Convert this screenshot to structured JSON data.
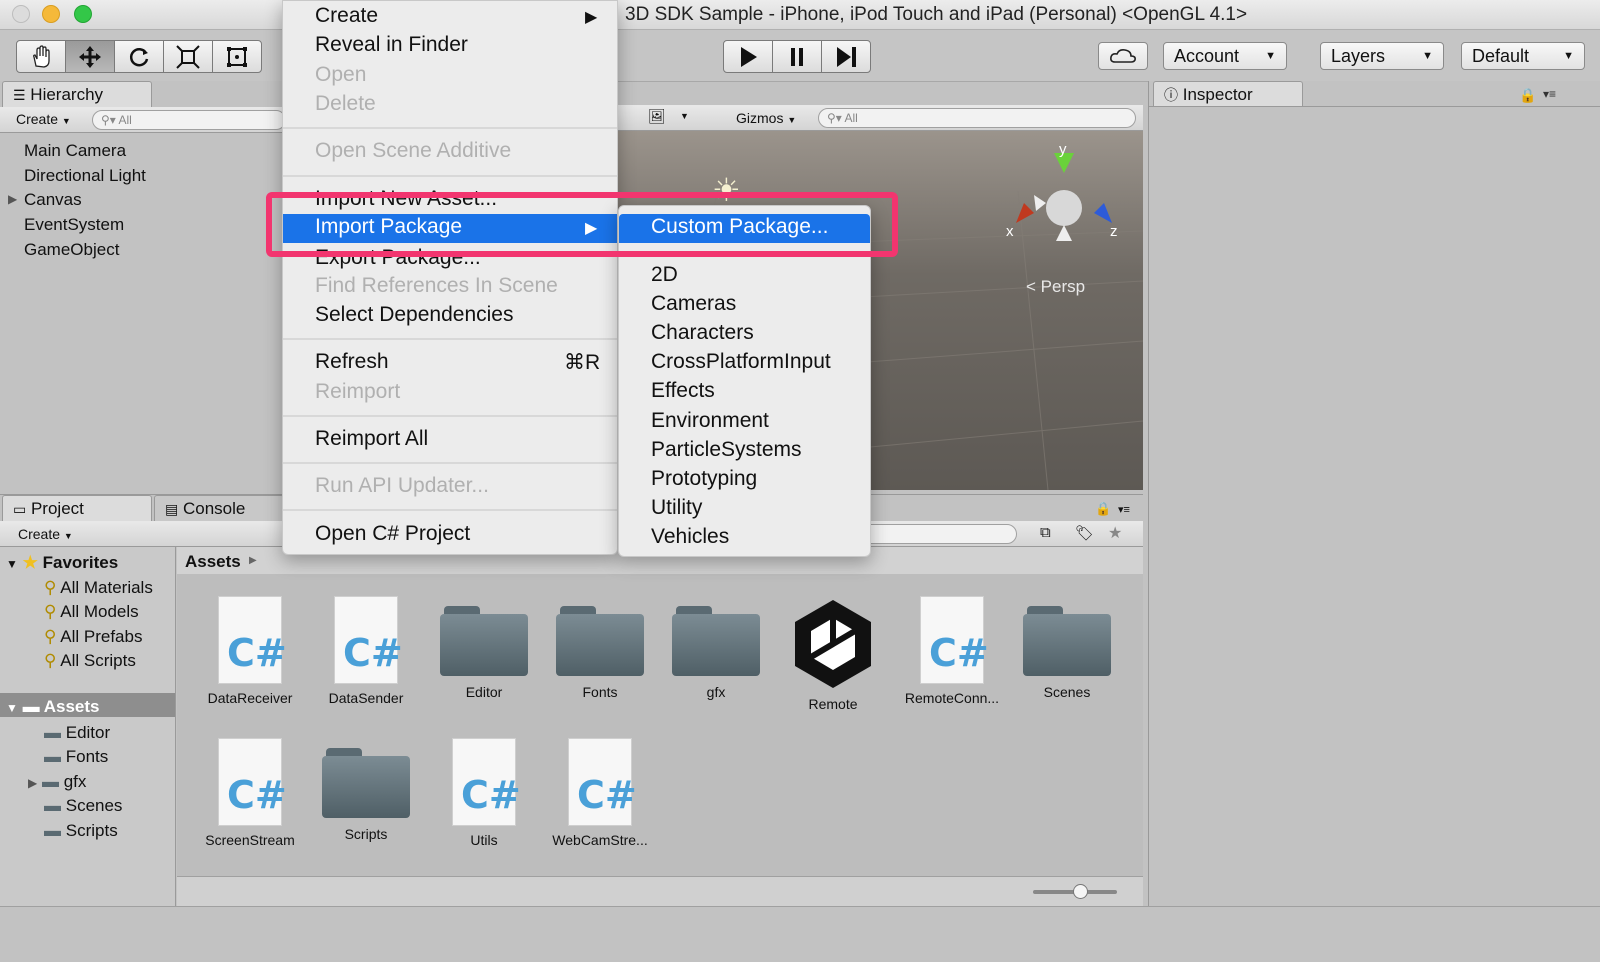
{
  "window": {
    "title": "3D SDK Sample - iPhone, iPod Touch and iPad (Personal) <OpenGL 4.1>"
  },
  "toolbar": {
    "account": "Account",
    "layers": "Layers",
    "layout": "Default"
  },
  "hierarchy": {
    "tab": "Hierarchy",
    "create": "Create",
    "search_placeholder": "All",
    "items": [
      "Main Camera",
      "Directional Light",
      "Canvas",
      "EventSystem",
      "GameObject"
    ]
  },
  "scene": {
    "gizmos": "Gizmos",
    "search_placeholder": "All",
    "persp": "Persp",
    "axes": {
      "y": "y",
      "x": "x",
      "z": "z"
    }
  },
  "inspector": {
    "tab": "Inspector"
  },
  "project": {
    "tab": "Project",
    "console_tab": "Console",
    "create": "Create",
    "favorites": {
      "label": "Favorites",
      "items": [
        "All Materials",
        "All Models",
        "All Prefabs",
        "All Scripts"
      ]
    },
    "assets_tree": {
      "label": "Assets",
      "items": [
        "Editor",
        "Fonts",
        "gfx",
        "Scenes",
        "Scripts"
      ]
    },
    "breadcrumb": "Assets",
    "assets": [
      "DataReceiver",
      "DataSender",
      "Editor",
      "Fonts",
      "gfx",
      "Remote",
      "RemoteConn...",
      "Scenes",
      "ScreenStream",
      "Scripts",
      "Utils",
      "WebCamStre..."
    ]
  },
  "context_menu": {
    "create": "Create",
    "reveal": "Reveal in Finder",
    "open": "Open",
    "delete": "Delete",
    "open_additive": "Open Scene Additive",
    "import_new": "Import New Asset...",
    "import_package": "Import Package",
    "export_package": "Export Package...",
    "find_refs": "Find References In Scene",
    "select_deps": "Select Dependencies",
    "refresh": "Refresh",
    "refresh_shortcut": "⌘R",
    "reimport": "Reimport",
    "reimport_all": "Reimport All",
    "run_api": "Run API Updater...",
    "open_csharp": "Open C# Project"
  },
  "submenu": {
    "custom": "Custom Package...",
    "items": [
      "2D",
      "Cameras",
      "Characters",
      "CrossPlatformInput",
      "Effects",
      "Environment",
      "ParticleSystems",
      "Prototyping",
      "Utility",
      "Vehicles"
    ]
  },
  "colors": {
    "highlight": "#1a73e8",
    "annotation": "#f2356f"
  }
}
